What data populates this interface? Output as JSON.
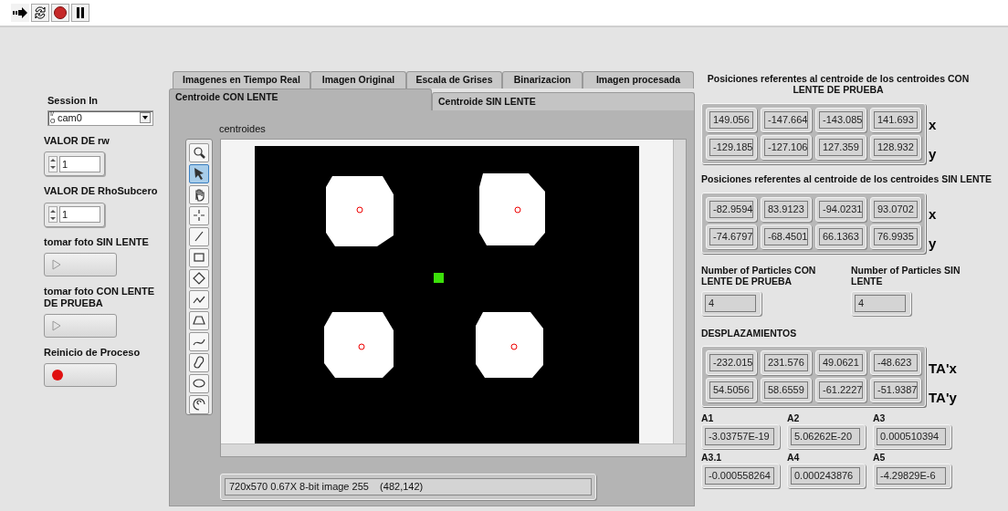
{
  "toolbar": {
    "buttons": [
      {
        "kind": "run"
      },
      {
        "kind": "run-continuous"
      },
      {
        "kind": "abort"
      },
      {
        "kind": "pause"
      }
    ]
  },
  "controls": {
    "session": {
      "label": "Session In",
      "prefix": "I/O",
      "value": "cam0"
    },
    "numerics": [
      {
        "label": "VALOR DE rw",
        "value": "1"
      },
      {
        "label": "VALOR DE RhoSubcero",
        "value": "1"
      }
    ],
    "buttons": [
      {
        "label": "tomar foto SIN LENTE",
        "kind": "play",
        "on": false
      },
      {
        "label": "tomar foto CON LENTE DE PRUEBA",
        "kind": "play",
        "on": false
      },
      {
        "label": "Reinicio de Proceso",
        "kind": "led",
        "on": true
      }
    ]
  },
  "tabs": {
    "items": [
      {
        "label": "Imagenes en Tiempo Real",
        "kind": "back",
        "selected": false
      },
      {
        "label": "Imagen Original",
        "kind": "back",
        "selected": false
      },
      {
        "label": "Escala de Grises",
        "kind": "back",
        "selected": false
      },
      {
        "label": "Binarizacion",
        "kind": "back",
        "selected": false
      },
      {
        "label": "Imagen procesada",
        "kind": "back",
        "selected": false
      },
      {
        "label": "Centroide CON LENTE",
        "kind": "front",
        "selected": true
      },
      {
        "label": "Centroide SIN LENTE",
        "kind": "front",
        "selected": false
      }
    ],
    "image_display": {
      "label": "centroides",
      "status": "720x570 0.67X 8-bit image 255    (482,142)",
      "tools": [
        {
          "kind": "zoom",
          "selected": false
        },
        {
          "kind": "pointer",
          "selected": true
        },
        {
          "kind": "pan",
          "selected": false
        },
        {
          "kind": "point",
          "selected": false
        },
        {
          "kind": "line",
          "selected": false
        },
        {
          "kind": "rectangle",
          "selected": false
        },
        {
          "kind": "rotated-rectangle",
          "selected": false
        },
        {
          "kind": "polyline",
          "selected": false
        },
        {
          "kind": "polygon",
          "selected": false
        },
        {
          "kind": "freeline",
          "selected": false
        },
        {
          "kind": "freehand",
          "selected": false
        },
        {
          "kind": "oval",
          "selected": false
        },
        {
          "kind": "annulus",
          "selected": false
        }
      ]
    }
  },
  "results": {
    "arrays": [
      {
        "title": "Posiciones referentes al centroide de los centroides CON LENTE DE PRUEBA",
        "centered": true,
        "rows": [
          {
            "label": "x",
            "values": [
              "149.056",
              "-147.664",
              "-143.085",
              "141.693"
            ]
          },
          {
            "label": "y",
            "values": [
              "-129.185",
              "-127.106",
              "127.359",
              "128.932"
            ]
          }
        ]
      },
      {
        "title": "Posiciones referentes al centroide de los centroides SIN LENTE",
        "centered": false,
        "rows": [
          {
            "label": "x",
            "values": [
              "-82.9594",
              "83.9123",
              "-94.0231",
              "93.0702"
            ]
          },
          {
            "label": "y",
            "values": [
              "-74.6797",
              "-68.4501",
              "66.1363",
              "76.9935"
            ]
          }
        ]
      }
    ],
    "particles": [
      {
        "label": "Number of Particles CON LENTE DE PRUEBA",
        "value": "4"
      },
      {
        "label": "Number of Particles SIN LENTE",
        "value": "4"
      }
    ],
    "displacements": {
      "title": "DESPLAZAMIENTOS",
      "rows": [
        {
          "label": "TA'x",
          "values": [
            "-232.015",
            "231.576",
            "49.0621",
            "-48.623"
          ]
        },
        {
          "label": "TA'y",
          "values": [
            "54.5056",
            "58.6559",
            "-61.2227",
            "-51.9387"
          ]
        }
      ]
    },
    "coefficients": [
      {
        "label": "A1",
        "value": "-3.03757E-19"
      },
      {
        "label": "A2",
        "value": "5.06262E-20"
      },
      {
        "label": "A3",
        "value": "0.000510394"
      },
      {
        "label": "A3.1",
        "value": "-0.000558264"
      },
      {
        "label": "A4",
        "value": "0.000243876"
      },
      {
        "label": "A5",
        "value": "-4.29829E-6"
      }
    ]
  }
}
